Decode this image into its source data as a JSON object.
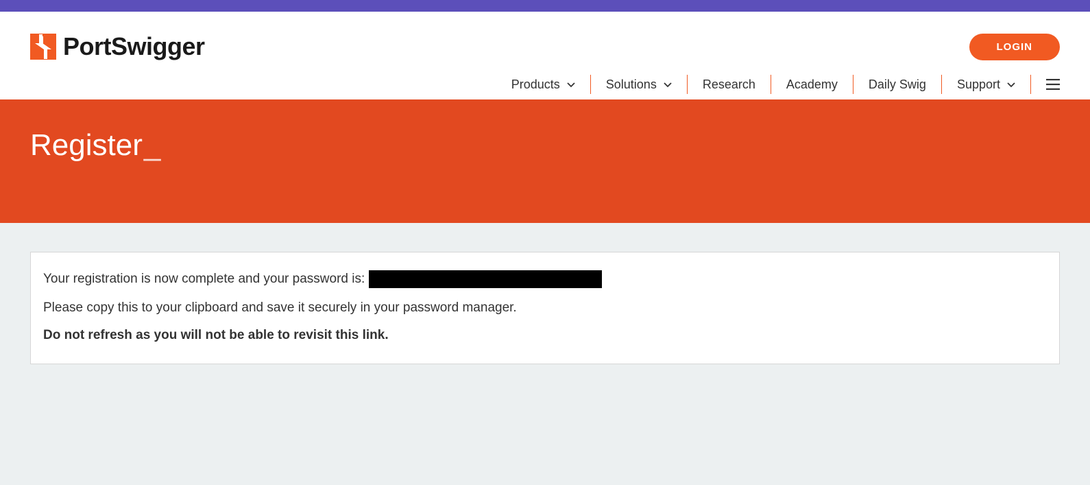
{
  "brand": {
    "name": "PortSwigger"
  },
  "header": {
    "login_label": "LOGIN"
  },
  "nav": {
    "items": [
      {
        "label": "Products",
        "has_dropdown": true
      },
      {
        "label": "Solutions",
        "has_dropdown": true
      },
      {
        "label": "Research",
        "has_dropdown": false
      },
      {
        "label": "Academy",
        "has_dropdown": false
      },
      {
        "label": "Daily Swig",
        "has_dropdown": false
      },
      {
        "label": "Support",
        "has_dropdown": true
      }
    ]
  },
  "hero": {
    "title": "Register",
    "cursor": "_"
  },
  "message": {
    "line1_prefix": "Your registration is now complete and your password is: ",
    "line2": "Please copy this to your clipboard and save it securely in your password manager.",
    "line3": "Do not refresh as you will not be able to revisit this link."
  }
}
